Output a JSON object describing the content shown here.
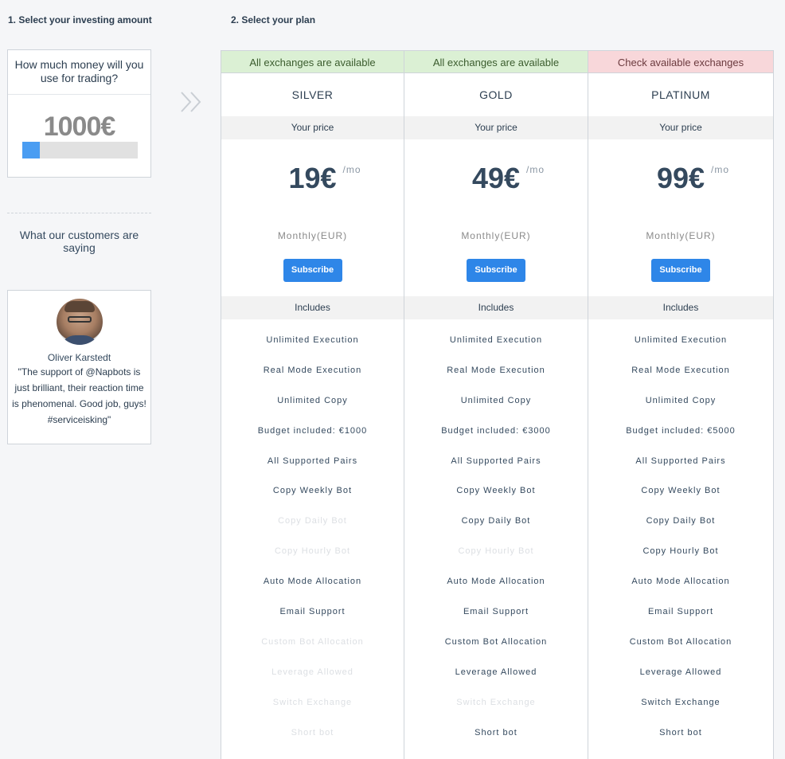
{
  "steps": {
    "step1": "1. Select your investing amount",
    "step2": "2. Select your plan"
  },
  "amount": {
    "question": "How much money will you use for trading?",
    "value": "1000€",
    "slider_fraction": 0.15
  },
  "customers": {
    "title": "What our customers are saying",
    "name": "Oliver Karstedt",
    "quote": "\"The support of @Napbots is just brilliant, their reaction time is phenomenal. Good job, guys! #serviceisking\""
  },
  "colors": {
    "accent": "#2e86e8",
    "available": "#dbf0d4",
    "check": "#f8d7da"
  },
  "plans": [
    {
      "availability": "All exchanges are available",
      "availability_status": "ok",
      "name": "SILVER",
      "price_label": "Your price",
      "price": "19€",
      "per": "/mo",
      "billing": "Monthly(EUR)",
      "subscribe": "Subscribe",
      "includes": "Includes",
      "features": [
        {
          "label": "Unlimited Execution",
          "on": true
        },
        {
          "label": "Real Mode Execution",
          "on": true
        },
        {
          "label": "Unlimited Copy",
          "on": true
        },
        {
          "label": "Budget included: €1000",
          "on": true
        },
        {
          "label": "All Supported Pairs",
          "on": true
        },
        {
          "label": "Copy Weekly Bot",
          "on": true
        },
        {
          "label": "Copy Daily Bot",
          "on": false
        },
        {
          "label": "Copy Hourly Bot",
          "on": false
        },
        {
          "label": "Auto Mode Allocation",
          "on": true
        },
        {
          "label": "Email Support",
          "on": true
        },
        {
          "label": "Custom Bot Allocation",
          "on": false
        },
        {
          "label": "Leverage Allowed",
          "on": false
        },
        {
          "label": "Switch Exchange",
          "on": false
        },
        {
          "label": "Short bot",
          "on": false
        }
      ]
    },
    {
      "availability": "All exchanges are available",
      "availability_status": "ok",
      "name": "GOLD",
      "price_label": "Your price",
      "price": "49€",
      "per": "/mo",
      "billing": "Monthly(EUR)",
      "subscribe": "Subscribe",
      "includes": "Includes",
      "features": [
        {
          "label": "Unlimited Execution",
          "on": true
        },
        {
          "label": "Real Mode Execution",
          "on": true
        },
        {
          "label": "Unlimited Copy",
          "on": true
        },
        {
          "label": "Budget included: €3000",
          "on": true
        },
        {
          "label": "All Supported Pairs",
          "on": true
        },
        {
          "label": "Copy Weekly Bot",
          "on": true
        },
        {
          "label": "Copy Daily Bot",
          "on": true
        },
        {
          "label": "Copy Hourly Bot",
          "on": false
        },
        {
          "label": "Auto Mode Allocation",
          "on": true
        },
        {
          "label": "Email Support",
          "on": true
        },
        {
          "label": "Custom Bot Allocation",
          "on": true
        },
        {
          "label": "Leverage Allowed",
          "on": true
        },
        {
          "label": "Switch Exchange",
          "on": false
        },
        {
          "label": "Short bot",
          "on": true
        }
      ]
    },
    {
      "availability": "Check available exchanges",
      "availability_status": "warn",
      "name": "PLATINUM",
      "price_label": "Your price",
      "price": "99€",
      "per": "/mo",
      "billing": "Monthly(EUR)",
      "subscribe": "Subscribe",
      "includes": "Includes",
      "features": [
        {
          "label": "Unlimited Execution",
          "on": true
        },
        {
          "label": "Real Mode Execution",
          "on": true
        },
        {
          "label": "Unlimited Copy",
          "on": true
        },
        {
          "label": "Budget included: €5000",
          "on": true
        },
        {
          "label": "All Supported Pairs",
          "on": true
        },
        {
          "label": "Copy Weekly Bot",
          "on": true
        },
        {
          "label": "Copy Daily Bot",
          "on": true
        },
        {
          "label": "Copy Hourly Bot",
          "on": true
        },
        {
          "label": "Auto Mode Allocation",
          "on": true
        },
        {
          "label": "Email Support",
          "on": true
        },
        {
          "label": "Custom Bot Allocation",
          "on": true
        },
        {
          "label": "Leverage Allowed",
          "on": true
        },
        {
          "label": "Switch Exchange",
          "on": true
        },
        {
          "label": "Short bot",
          "on": true
        }
      ]
    }
  ]
}
